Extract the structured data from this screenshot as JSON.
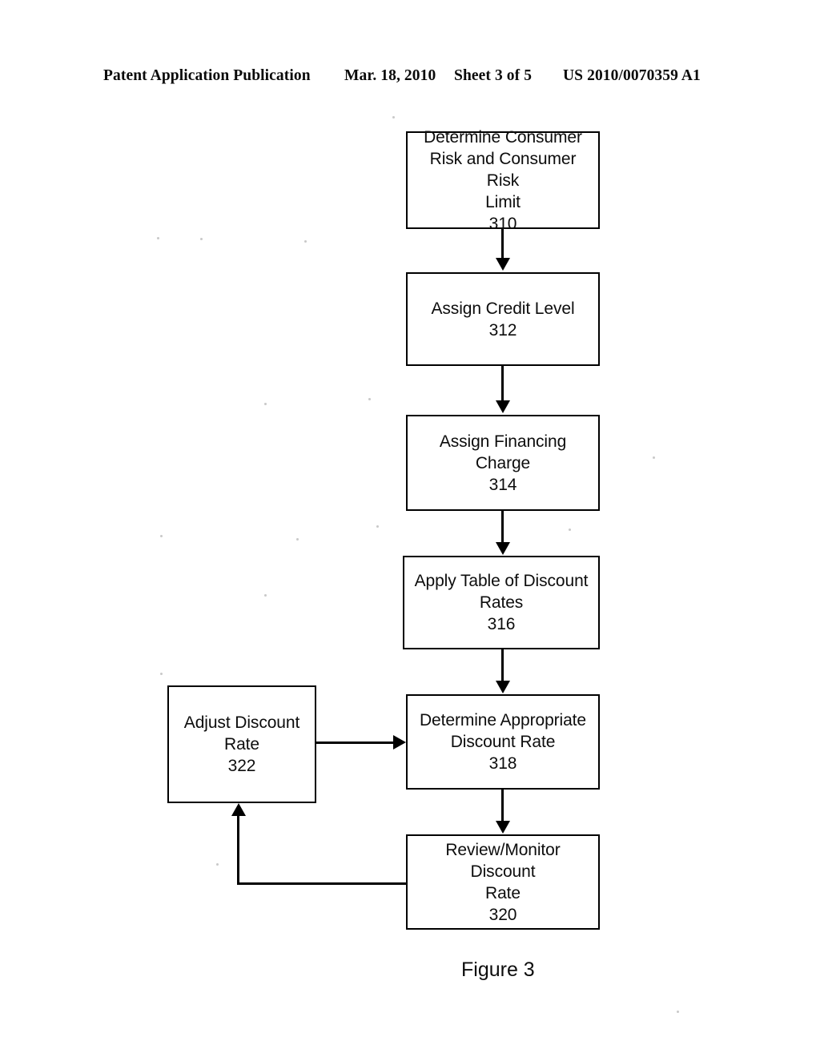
{
  "header": {
    "publication": "Patent Application Publication",
    "date": "Mar. 18, 2010",
    "sheet": "Sheet 3 of 5",
    "patent_number": "US 2010/0070359 A1"
  },
  "figure": {
    "caption": "Figure 3",
    "type": "flowchart",
    "nodes": [
      {
        "id": "310",
        "label": "Determine Consumer\nRisk and Consumer Risk\nLimit\n310"
      },
      {
        "id": "312",
        "label": "Assign Credit Level\n312"
      },
      {
        "id": "314",
        "label": "Assign Financing Charge\n314"
      },
      {
        "id": "316",
        "label": "Apply Table of Discount\nRates\n316"
      },
      {
        "id": "318",
        "label": "Determine Appropriate\nDiscount Rate\n318"
      },
      {
        "id": "320",
        "label": "Review/Monitor Discount\nRate\n320"
      },
      {
        "id": "322",
        "label": "Adjust Discount\nRate\n322"
      }
    ],
    "edges": [
      {
        "from": "310",
        "to": "312",
        "direction": "down"
      },
      {
        "from": "312",
        "to": "314",
        "direction": "down"
      },
      {
        "from": "314",
        "to": "316",
        "direction": "down"
      },
      {
        "from": "316",
        "to": "318",
        "direction": "down"
      },
      {
        "from": "318",
        "to": "320",
        "direction": "down"
      },
      {
        "from": "322",
        "to": "318",
        "direction": "right"
      },
      {
        "from": "320",
        "to": "322",
        "direction": "feedback-up"
      }
    ]
  },
  "colors": {
    "ink": "#000000",
    "paper": "#ffffff"
  }
}
